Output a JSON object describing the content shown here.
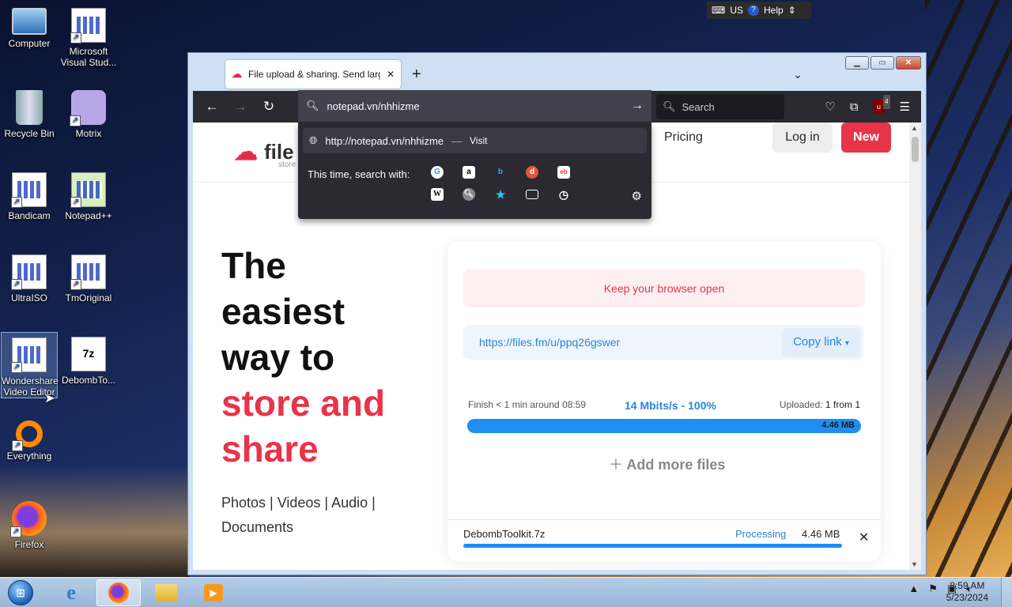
{
  "desktop": {
    "icons": [
      {
        "label": "Computer",
        "glyph": "computer-icon"
      },
      {
        "label": "Microsoft Visual Stud...",
        "glyph": "shortcut-app-icon"
      },
      {
        "label": "Recycle Bin",
        "glyph": "recycle-bin-icon"
      },
      {
        "label": "Motrix",
        "glyph": "motrix-icon"
      },
      {
        "label": "Bandicam",
        "glyph": "shortcut-app-icon"
      },
      {
        "label": "Notepad++",
        "glyph": "notepadpp-icon"
      },
      {
        "label": "UltraISO",
        "glyph": "shortcut-app-icon"
      },
      {
        "label": "TmOriginal",
        "glyph": "shortcut-app-icon"
      },
      {
        "label": "Wondershare Video Editor",
        "glyph": "shortcut-app-icon"
      },
      {
        "label": "DebombTo...",
        "glyph": "7z-archive-icon"
      },
      {
        "label": "Everything",
        "glyph": "everything-icon"
      },
      {
        "label": "Firefox",
        "glyph": "firefox-icon"
      }
    ]
  },
  "langbar": {
    "lang": "US",
    "help": "Help"
  },
  "browser": {
    "tab_title": "File upload & sharing. Send large files",
    "url_input": "notepad.vn/nhhizme",
    "search_placeholder": "Search",
    "ublock_count": "4",
    "dropdown": {
      "suggestion_url": "http://notepad.vn/nhhizme",
      "suggestion_sep": "—",
      "suggestion_action": "Visit",
      "engines_label": "This time, search with:"
    }
  },
  "site": {
    "logo_text": "file",
    "logo_sub": "store",
    "pricing": "Pricing",
    "login": "Log in",
    "new": "New",
    "hero": {
      "line1": "The",
      "line2": "easiest",
      "line3": "way to",
      "line4": "store and",
      "line5": "share"
    },
    "media_line": "Photos | Videos | Audio | Documents",
    "card": {
      "notice": "Keep your browser open",
      "share_url": "https://files.fm/u/ppq26gswer",
      "copy_link": "Copy link",
      "finish": "Finish < 1 min around 08:59",
      "speed": "14 Mbits/s - 100%",
      "uploaded_label": "Uploaded:",
      "uploaded_value": "1 from 1",
      "total_size": "4.46 MB",
      "add_more": "Add more files",
      "file_name": "DebombToolkit.7z",
      "file_status": "Processing",
      "file_size": "4.46 MB",
      "progress": 1.0
    }
  },
  "taskbar": {
    "time": "8:59 AM",
    "date": "5/23/2024"
  }
}
